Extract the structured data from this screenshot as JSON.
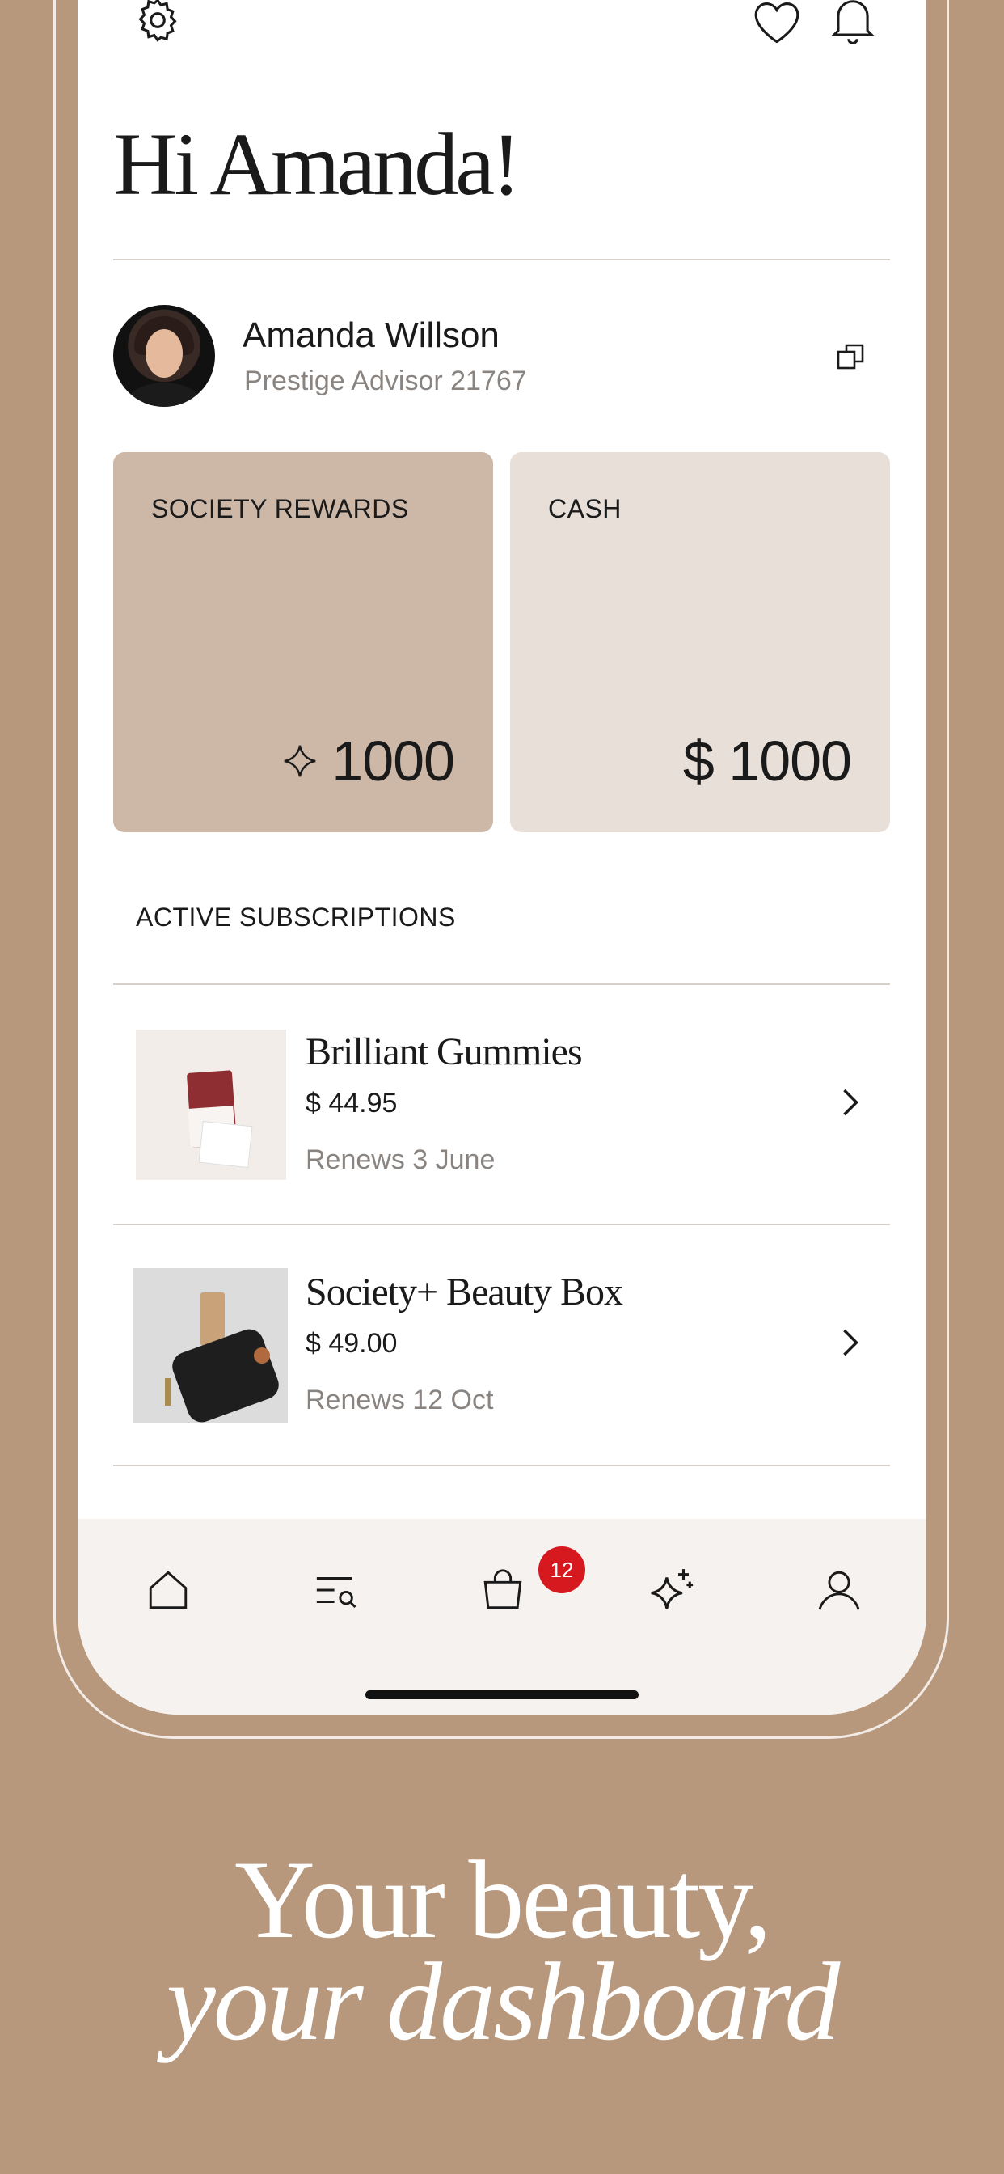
{
  "header": {
    "greeting": "Hi Amanda!"
  },
  "profile": {
    "name": "Amanda Willson",
    "subtitle": "Prestige Advisor 21767"
  },
  "cards": {
    "rewards": {
      "label": "SOCIETY REWARDS",
      "value": "1000",
      "icon": "sparkle-icon",
      "color": "#cdb8a8"
    },
    "cash": {
      "label": "CASH",
      "value": "$ 1000",
      "color": "#e8dfd8"
    }
  },
  "subscriptions": {
    "title": "ACTIVE SUBSCRIPTIONS",
    "items": [
      {
        "name": "Brilliant Gummies",
        "price": "$ 44.95",
        "renews": "Renews 3 June"
      },
      {
        "name": "Society+ Beauty Box",
        "price": "$ 49.00",
        "renews": "Renews 12 Oct"
      }
    ]
  },
  "tabbar": {
    "items": [
      "home-icon",
      "search-list-icon",
      "bag-icon",
      "sparkle-icon",
      "user-icon"
    ],
    "bag_badge": "12",
    "badge_color": "#d5191e"
  },
  "tagline": {
    "line1": "Your beauty,",
    "line2": "your dashboard"
  },
  "colors": {
    "background": "#b8987c",
    "tabbar": "#f5f2ef"
  }
}
